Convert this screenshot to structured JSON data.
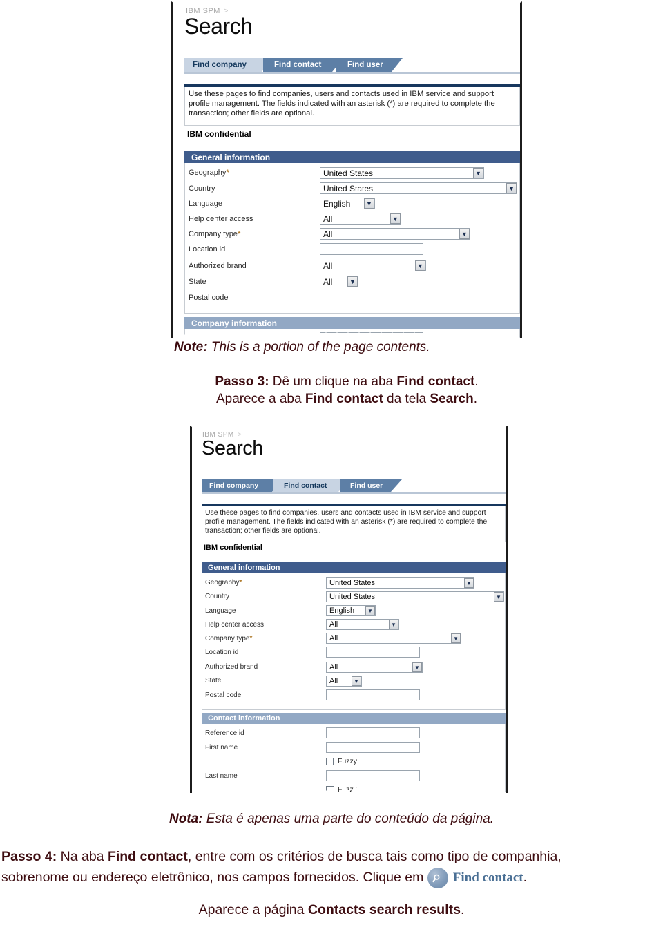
{
  "screenshot_one": {
    "breadcrumb": "IBM SPM",
    "breadcrumb_sep": ">",
    "page_title": "Search",
    "tabs": [
      {
        "label": "Find company",
        "active": true
      },
      {
        "label": "Find contact",
        "active": false
      },
      {
        "label": "Find user",
        "active": false
      }
    ],
    "intro": "Use these pages to find companies, users and contacts used in IBM service and support profile management. The fields indicated with an asterisk (*) are required to complete the transaction; other fields are optional.",
    "confidential": "IBM confidential",
    "general_section": "General information",
    "fields": [
      {
        "label": "Geography",
        "required": true,
        "type": "select",
        "value": "United States"
      },
      {
        "label": "Country",
        "required": false,
        "type": "select",
        "value": "United States"
      },
      {
        "label": "Language",
        "required": false,
        "type": "select",
        "value": "English"
      },
      {
        "label": "Help center access",
        "required": false,
        "type": "select",
        "value": "All"
      },
      {
        "label": "Company type",
        "required": true,
        "type": "select",
        "value": "All"
      },
      {
        "label": "Location id",
        "required": false,
        "type": "input",
        "value": ""
      },
      {
        "label": "Authorized brand",
        "required": false,
        "type": "select",
        "value": "All"
      },
      {
        "label": "State",
        "required": false,
        "type": "select",
        "value": "All"
      },
      {
        "label": "Postal code",
        "required": false,
        "type": "input",
        "value": ""
      }
    ],
    "company_section": "Company information"
  },
  "note_one": {
    "prefix": "Note:",
    "text": " This is a portion of the page contents."
  },
  "passo3": {
    "step": "Passo 3:",
    "t1": " Dê um clique na aba ",
    "b1": "Find contact",
    "t2": ".",
    "t3": "Aparece a aba ",
    "b2": "Find contact",
    "t4": " da tela ",
    "b3": "Search",
    "t5": "."
  },
  "screenshot_two": {
    "breadcrumb": "IBM SPM",
    "breadcrumb_sep": ">",
    "page_title": "Search",
    "tabs": [
      {
        "label": "Find company",
        "active": false
      },
      {
        "label": "Find contact",
        "active": true
      },
      {
        "label": "Find user",
        "active": false
      }
    ],
    "intro": "Use these pages to find companies, users and contacts used in IBM service and support profile management. The fields indicated with an asterisk (*) are required to complete the transaction; other fields are optional.",
    "confidential": "IBM confidential",
    "general_section": "General information",
    "fields": [
      {
        "label": "Geography",
        "required": true,
        "type": "select",
        "value": "United States"
      },
      {
        "label": "Country",
        "required": false,
        "type": "select",
        "value": "United States"
      },
      {
        "label": "Language",
        "required": false,
        "type": "select",
        "value": "English"
      },
      {
        "label": "Help center access",
        "required": false,
        "type": "select",
        "value": "All"
      },
      {
        "label": "Company type",
        "required": true,
        "type": "select",
        "value": "All"
      },
      {
        "label": "Location id",
        "required": false,
        "type": "input",
        "value": ""
      },
      {
        "label": "Authorized brand",
        "required": false,
        "type": "select",
        "value": "All"
      },
      {
        "label": "State",
        "required": false,
        "type": "select",
        "value": "All"
      },
      {
        "label": "Postal code",
        "required": false,
        "type": "input",
        "value": ""
      }
    ],
    "contact_section": "Contact information",
    "contact_fields": [
      {
        "label": "Reference id",
        "type": "input",
        "value": ""
      },
      {
        "label": "First name",
        "type": "input",
        "value": ""
      },
      {
        "label": "Last name",
        "type": "input",
        "value": ""
      }
    ],
    "fuzzy_label": "Fuzzy"
  },
  "note_two": {
    "prefix": "Nota:",
    "text": " Esta é apenas uma parte do conteúdo da página."
  },
  "passo4": {
    "step": "Passo 4:",
    "t1": " Na aba ",
    "b1": "Find contact",
    "t2": ", entre com os critérios de busca tais como tipo de companhia,",
    "t3": "sobrenome ou endereço eletrônico, nos campos fornecidos. Clique em ",
    "button_label": "Find contact",
    "t4": ".",
    "t5": "Aparece a página ",
    "b2": "Contacts search results",
    "t6": "."
  },
  "colors": {
    "tab_inactive": "#5d7fa6",
    "tab_active": "#c8d4e3",
    "section_header": "#3f5c8c",
    "section_header_light": "#92a8c4",
    "panel_topbar": "#17375e",
    "narrative_text": "#3d0c10",
    "button_blue": "#4a6f94"
  }
}
